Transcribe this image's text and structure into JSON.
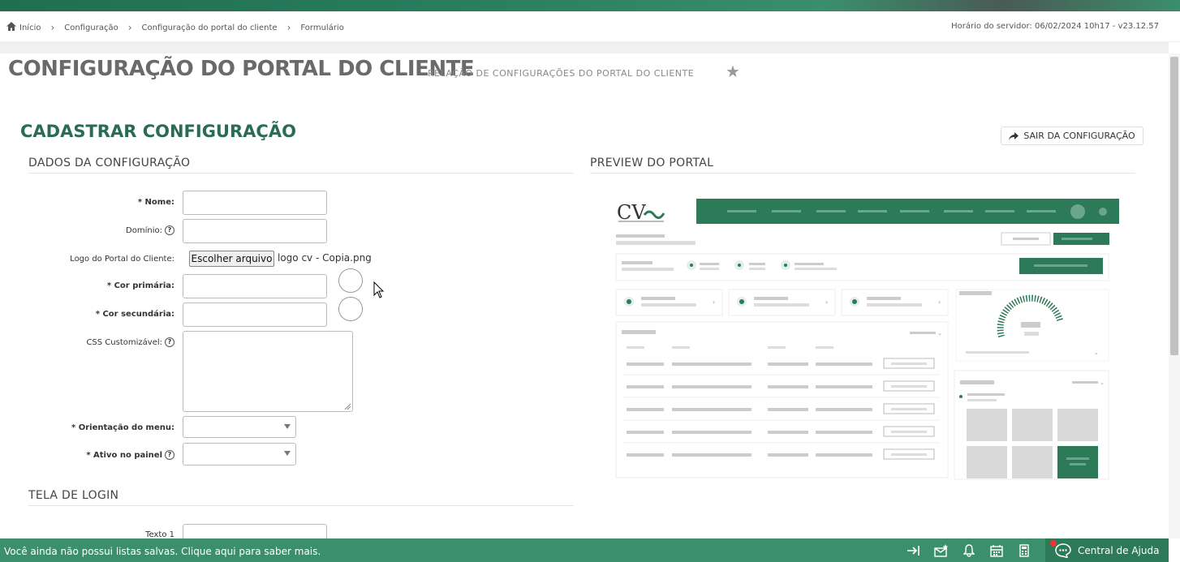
{
  "breadcrumb": {
    "items": [
      "Início",
      "Configuração",
      "Configuração do portal do cliente",
      "Formulário"
    ]
  },
  "server_time": "Horário do servidor: 06/02/2024 10h17 - v23.12.57",
  "page": {
    "title": "CONFIGURAÇÃO DO PORTAL DO CLIENTE",
    "subtitle": "RELAÇÃO DE CONFIGURAÇÕES DO PORTAL DO CLIENTE"
  },
  "section_title": "CADASTRAR CONFIGURAÇÃO",
  "exit_button": "SAIR DA CONFIGURAÇÃO",
  "config_section": {
    "heading": "DADOS DA CONFIGURAÇÃO",
    "fields": {
      "nome": "* Nome:",
      "dominio": "Domínio:",
      "logo": "Logo do Portal do Cliente:",
      "cor_primaria": "* Cor primária:",
      "cor_secundaria": "* Cor secundária:",
      "css": "CSS Customizável:",
      "orientacao": "* Orientação do menu:",
      "ativo": "* Ativo no painel"
    },
    "file_button": "Escolher arquivo",
    "file_name": "logo cv - Copia.png"
  },
  "login_section": {
    "heading": "TELA DE LOGIN",
    "texto1": "Texto 1"
  },
  "preview": {
    "heading": "PREVIEW DO PORTAL",
    "brand_color": "#2d7a58"
  },
  "footer": {
    "message": "Você ainda não possui listas salvas. Clique aqui para saber mais.",
    "help": "Central de Ajuda"
  }
}
